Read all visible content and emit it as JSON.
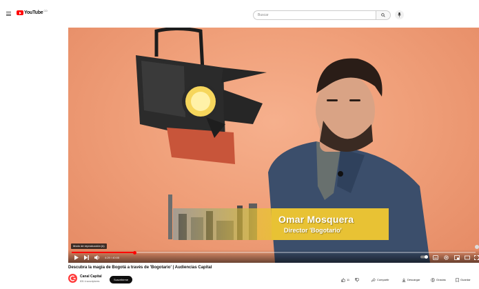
{
  "header": {
    "logo_text": "YouTube",
    "logo_region": "CO",
    "search_placeholder": "Buscar"
  },
  "player": {
    "lower_third": {
      "name": "Omar Mosquera",
      "role": "Director 'Bogotario'"
    },
    "speed_tooltip": "Modo de reproducción (k)",
    "time": "4:29 / 40:05",
    "progress": 0.155,
    "accent_color": "#ff0000"
  },
  "video": {
    "title": "Descubra la magia de Bogotá a través de 'Bogotario' | Audiencias Capital",
    "channel_name": "Canal Capital",
    "subscribers": "831 k suscriptores",
    "subscribe_label": "Suscribirme"
  },
  "actions": {
    "likes": "11",
    "share": "Compartir",
    "download": "Descargar",
    "thanks": "Gracias",
    "save": "Guardar"
  }
}
